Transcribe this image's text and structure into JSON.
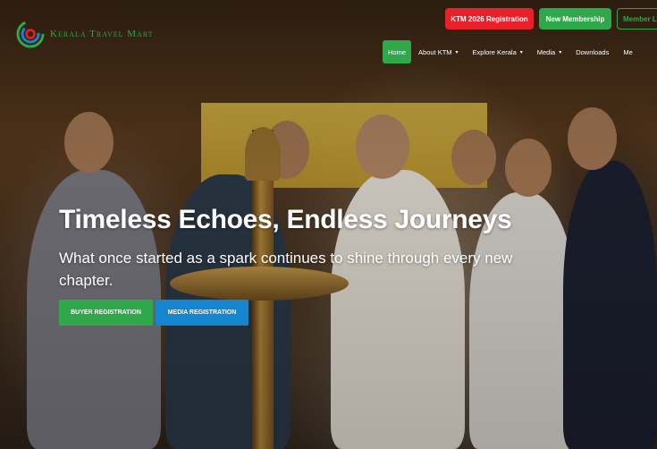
{
  "brand": {
    "logo_text": "Kerala Travel Mart",
    "accent": "#2ea84a"
  },
  "top_buttons": {
    "ktm": "KTM 2026 Registration",
    "new_membership": "New Membership",
    "member": "Member L"
  },
  "nav": [
    {
      "label": "Home",
      "active": true,
      "dropdown": false
    },
    {
      "label": "About KTM",
      "active": false,
      "dropdown": true
    },
    {
      "label": "Explore Kerala",
      "active": false,
      "dropdown": true
    },
    {
      "label": "Media",
      "active": false,
      "dropdown": true
    },
    {
      "label": "Downloads",
      "active": false,
      "dropdown": false
    },
    {
      "label": "Me",
      "active": false,
      "dropdown": false
    }
  ],
  "hero": {
    "headline": "Timeless Echoes, Endless Journeys",
    "subline": "What once started as a spark continues to shine through every new chapter."
  },
  "cta": {
    "buyer": "BUYER REGISTRATION",
    "media": "MEDIA REGISTRATION"
  },
  "colors": {
    "red": "#e8202a",
    "green": "#2ea84a",
    "blue": "#1585d0"
  }
}
